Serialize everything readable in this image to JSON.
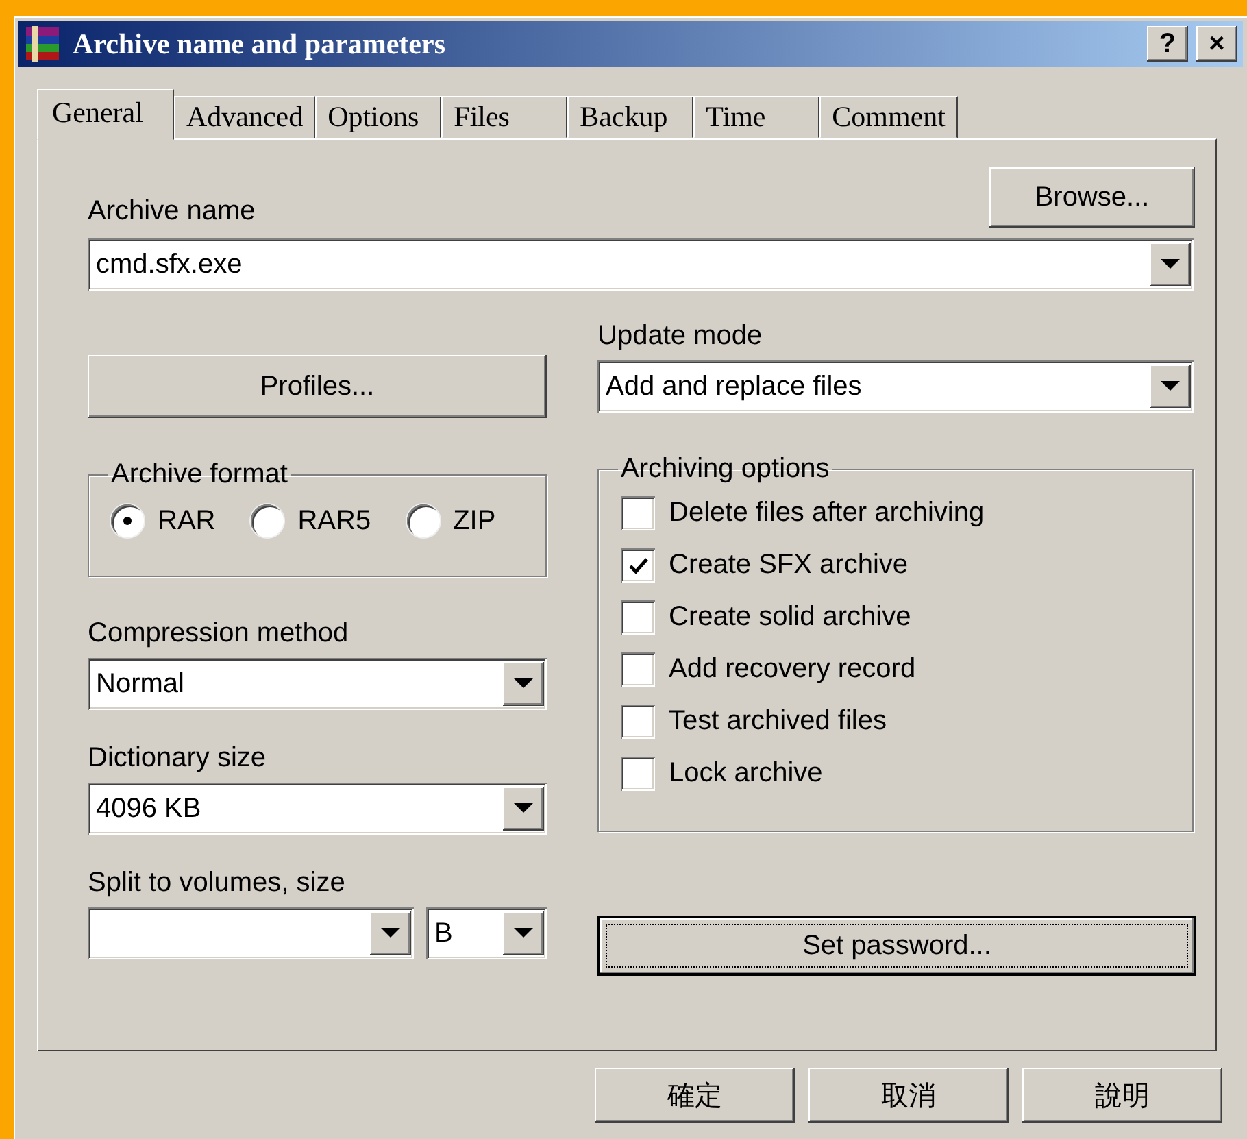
{
  "window": {
    "title": "Archive name and parameters",
    "help_button": "?",
    "close_button": "×"
  },
  "tabs": [
    {
      "label": "General",
      "selected": true
    },
    {
      "label": "Advanced",
      "selected": false
    },
    {
      "label": "Options",
      "selected": false
    },
    {
      "label": "Files",
      "selected": false
    },
    {
      "label": "Backup",
      "selected": false
    },
    {
      "label": "Time",
      "selected": false
    },
    {
      "label": "Comment",
      "selected": false
    }
  ],
  "archive_name": {
    "label": "Archive name",
    "value": "cmd.sfx.exe",
    "browse_button": "Browse..."
  },
  "profiles_button": "Profiles...",
  "update_mode": {
    "label": "Update mode",
    "value": "Add and replace files"
  },
  "archive_format": {
    "title": "Archive format",
    "options": [
      {
        "label": "RAR",
        "selected": true
      },
      {
        "label": "RAR5",
        "selected": false
      },
      {
        "label": "ZIP",
        "selected": false
      }
    ]
  },
  "compression_method": {
    "label": "Compression method",
    "value": "Normal"
  },
  "dictionary_size": {
    "label": "Dictionary size",
    "value": "4096 KB"
  },
  "split_volumes": {
    "label": "Split to volumes, size",
    "unit": "B"
  },
  "archiving_options": {
    "title": "Archiving options",
    "options": [
      {
        "label": "Delete files after archiving",
        "checked": false
      },
      {
        "label": "Create SFX archive",
        "checked": true
      },
      {
        "label": "Create solid archive",
        "checked": false
      },
      {
        "label": "Add recovery record",
        "checked": false
      },
      {
        "label": "Test archived files",
        "checked": false
      },
      {
        "label": "Lock archive",
        "checked": false
      }
    ]
  },
  "set_password_button": "Set password...",
  "buttons": [
    "確定",
    "取消",
    "說明"
  ]
}
